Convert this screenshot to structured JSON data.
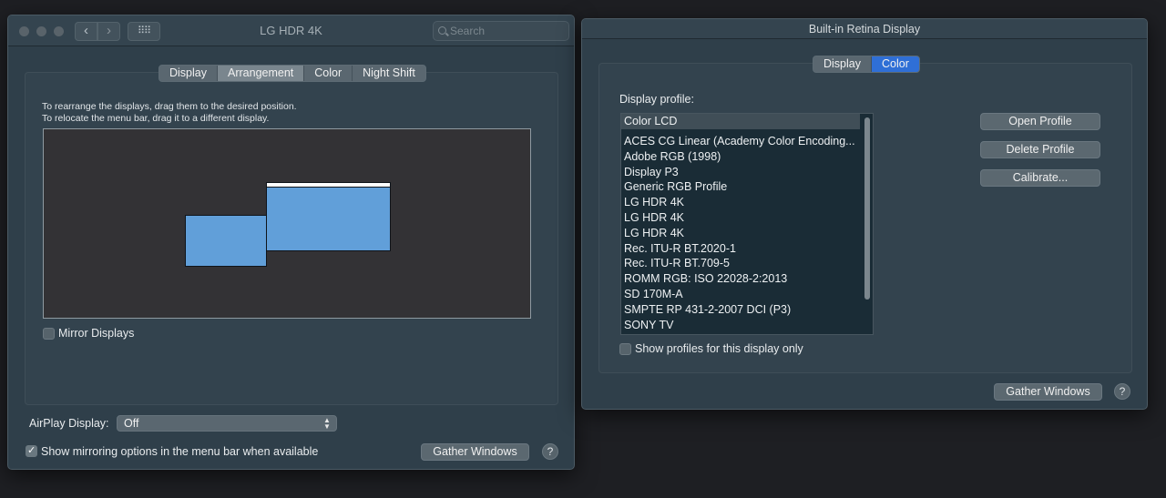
{
  "window_left": {
    "title": "LG HDR 4K",
    "nav": {
      "back": "‹",
      "forward": "›",
      "grid": "⠿⠿"
    },
    "search": {
      "placeholder": "Search"
    },
    "tabs": [
      "Display",
      "Arrangement",
      "Color",
      "Night Shift"
    ],
    "active_tab": "Arrangement",
    "instructions": [
      "To rearrange the displays, drag them to the desired position.",
      "To relocate the menu bar, drag it to a different display."
    ],
    "mirror_displays_label": "Mirror Displays",
    "mirror_displays_checked": false,
    "airplay_label": "AirPlay Display:",
    "airplay_value": "Off",
    "show_mirroring_label": "Show mirroring options in the menu bar when available",
    "show_mirroring_checked": true,
    "gather_windows": "Gather Windows",
    "help": "?"
  },
  "window_right": {
    "title": "Built-in Retina Display",
    "tabs": [
      "Display",
      "Color"
    ],
    "active_tab": "Color",
    "display_profile_label": "Display profile:",
    "profiles": [
      "Color LCD",
      "ACES CG Linear (Academy Color Encoding...",
      "Adobe RGB (1998)",
      "Display P3",
      "Generic RGB Profile",
      "LG HDR 4K",
      "LG HDR 4K",
      "LG HDR 4K",
      "Rec. ITU-R BT.2020-1",
      "Rec. ITU-R BT.709-5",
      "ROMM RGB: ISO 22028-2:2013",
      "SD 170M-A",
      "SMPTE RP 431-2-2007 DCI (P3)",
      "SONY TV"
    ],
    "selected_profile": "Color LCD",
    "buttons": {
      "open_profile": "Open Profile",
      "delete_profile": "Delete Profile",
      "calibrate": "Calibrate..."
    },
    "show_profiles_label": "Show profiles for this display only",
    "show_profiles_checked": false,
    "gather_windows": "Gather Windows",
    "help": "?"
  },
  "colors": {
    "window_bg": "#2f3f4a",
    "display_rect": "#619fd9",
    "active_blue": "#2f6fd6"
  }
}
